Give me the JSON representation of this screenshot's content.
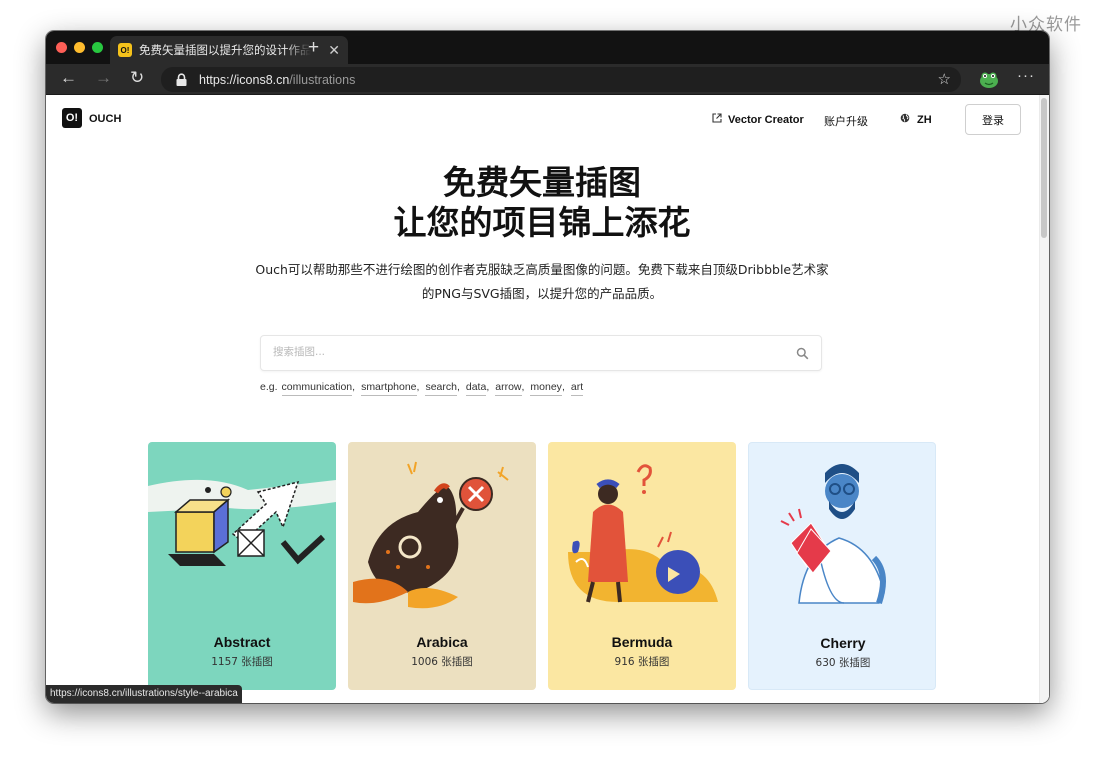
{
  "watermark": "小众软件",
  "browser": {
    "tab_title": "免费矢量插图以提升您的设计作品",
    "favicon_text": "O!",
    "url_host": "https://icons8.cn",
    "url_path": "/illustrations",
    "status_url": "https://icons8.cn/illustrations/style--arabica"
  },
  "header": {
    "logo_text": "O!",
    "brand": "OUCH",
    "vector_creator": "Vector Creator",
    "upgrade": "账户升级",
    "language": "ZH",
    "login": "登录"
  },
  "hero": {
    "title_line1": "免费矢量插图",
    "title_line2": "让您的项目锦上添花",
    "desc_line1": "Ouch可以帮助那些不进行绘图的创作者克服缺乏高质量图像的问题。免费下载来自顶级Dribbble艺术家",
    "desc_line2": "的PNG与SVG插图，以提升您的产品品质。"
  },
  "search": {
    "placeholder": "搜索插图...",
    "examples_prefix": "e.g.",
    "examples": [
      "communication",
      "smartphone",
      "search",
      "data",
      "arrow",
      "money",
      "art"
    ]
  },
  "cards": [
    {
      "name": "Abstract",
      "count": "1157 张插图",
      "bg": "#7dd6be"
    },
    {
      "name": "Arabica",
      "count": "1006 张插图",
      "bg": "#ece0c0"
    },
    {
      "name": "Bermuda",
      "count": "916 张插图",
      "bg": "#fbe7a2"
    },
    {
      "name": "Cherry",
      "count": "630 张插图",
      "bg": "#e5f2fd"
    }
  ]
}
